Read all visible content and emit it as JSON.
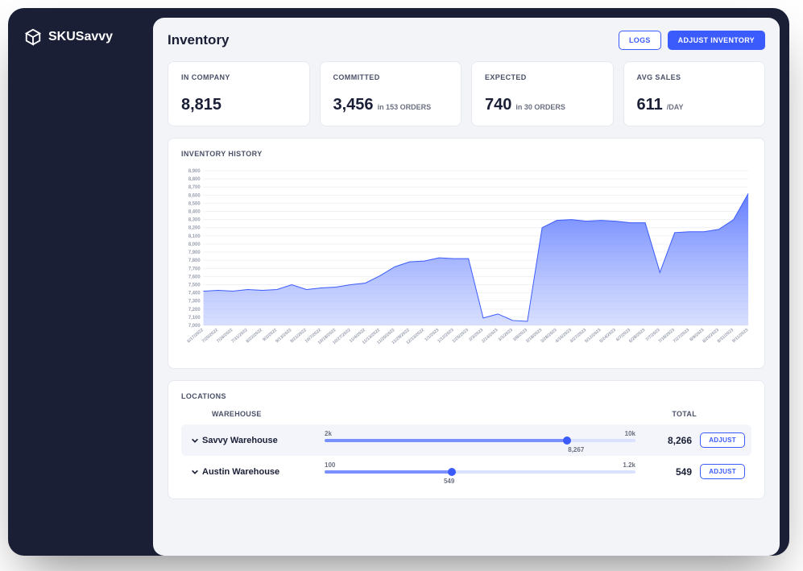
{
  "brand": "SKUSavvy",
  "page": {
    "title": "Inventory"
  },
  "header_actions": {
    "logs": "LOGS",
    "adjust": "ADJUST INVENTORY"
  },
  "stats": [
    {
      "label": "IN COMPANY",
      "value": "8,815",
      "sub": ""
    },
    {
      "label": "COMMITTED",
      "value": "3,456",
      "sub": "in 153 ORDERS"
    },
    {
      "label": "EXPECTED",
      "value": "740",
      "sub": "in 30 ORDERS"
    },
    {
      "label": "AVG SALES",
      "value": "611",
      "sub": "/DAY"
    }
  ],
  "history": {
    "title": "INVENTORY HISTORY"
  },
  "chart_data": {
    "type": "area",
    "title": "INVENTORY HISTORY",
    "xlabel": "",
    "ylabel": "",
    "ylim": [
      7000,
      8900
    ],
    "y_ticks": [
      7000,
      7100,
      7200,
      7300,
      7400,
      7500,
      7600,
      7700,
      7800,
      7900,
      8000,
      8100,
      8200,
      8300,
      8400,
      8500,
      8600,
      8700,
      8800,
      8900
    ],
    "categories": [
      "6/17/2022",
      "7/20/2022",
      "7/26/2022",
      "7/31/2022",
      "8/22/2022",
      "9/2/2022",
      "9/13/2022",
      "9/21/2022",
      "10/7/2022",
      "10/18/2022",
      "10/27/2022",
      "11/4/2022",
      "11/13/2022",
      "11/20/2022",
      "11/29/2022",
      "12/13/2022",
      "1/1/2023",
      "1/12/2023",
      "1/25/2023",
      "2/3/2023",
      "2/14/2023",
      "3/1/2023",
      "3/8/2023",
      "3/18/2023",
      "3/28/2023",
      "4/16/2023",
      "4/27/2023",
      "5/12/2023",
      "5/24/2023",
      "6/7/2023",
      "6/28/2023",
      "7/7/2023",
      "7/18/2023",
      "7/27/2023",
      "8/9/2023",
      "8/20/2023",
      "8/31/2023",
      "9/11/2023"
    ],
    "values": [
      7420,
      7430,
      7420,
      7440,
      7430,
      7440,
      7500,
      7440,
      7460,
      7470,
      7500,
      7520,
      7610,
      7720,
      7780,
      7790,
      7830,
      7820,
      7820,
      7090,
      7140,
      7060,
      7050,
      8200,
      8290,
      8300,
      8280,
      8290,
      8280,
      8260,
      8260,
      7650,
      8140,
      8150,
      8150,
      8180,
      8300,
      8620
    ]
  },
  "locations": {
    "title": "LOCATIONS",
    "col_warehouse": "WAREHOUSE",
    "col_total": "TOTAL",
    "rows": [
      {
        "name": "Savvy Warehouse",
        "min": "2k",
        "max": "10k",
        "total": "8,266",
        "value_label": "8,267",
        "pct": 78
      },
      {
        "name": "Austin Warehouse",
        "min": "100",
        "max": "1.2k",
        "total": "549",
        "value_label": "549",
        "pct": 41
      }
    ],
    "adjust_label": "ADJUST"
  }
}
